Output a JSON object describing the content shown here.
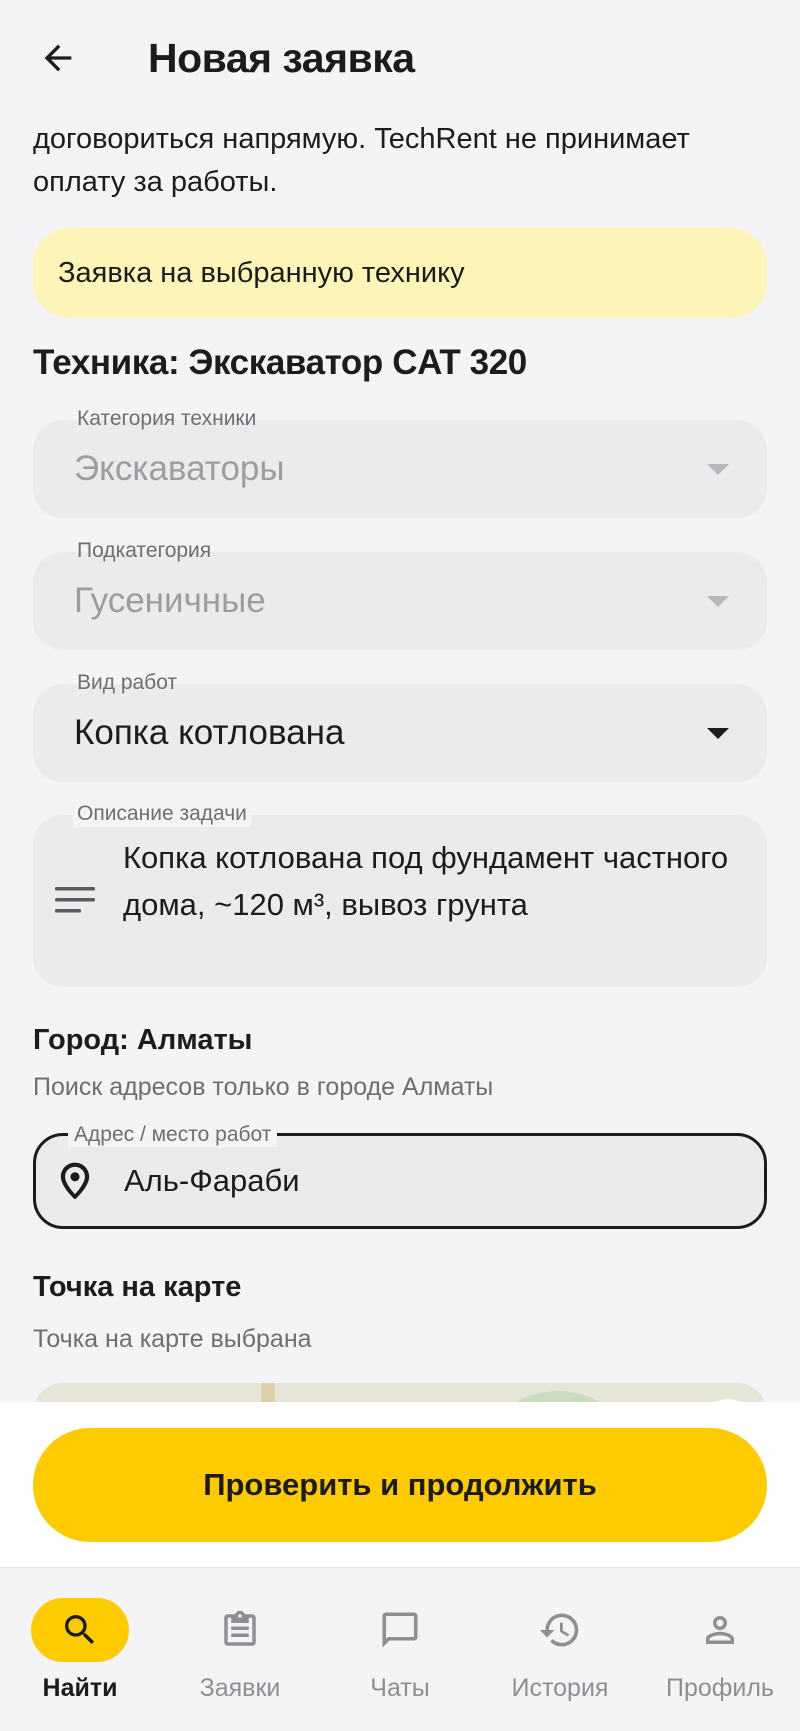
{
  "header": {
    "title": "Новая заявка",
    "back_icon": "arrow-left-icon"
  },
  "intro": {
    "text": "договориться напрямую. TechRent не принимает оплату за работы."
  },
  "banner": {
    "text": "Заявка на выбранную технику",
    "color": "#fdf4b8"
  },
  "equipment": {
    "title": "Техника: Экскаватор CAT 320"
  },
  "fields": {
    "category": {
      "label": "Категория техники",
      "value": "Экскаваторы",
      "disabled": true
    },
    "subcategory": {
      "label": "Подкатегория",
      "value": "Гусеничные",
      "disabled": true
    },
    "work_type": {
      "label": "Вид работ",
      "value": "Копка котлована",
      "disabled": false
    },
    "description": {
      "label": "Описание задачи",
      "value": "Копка котлована под фундамент частного дома, ~120 м³, вывоз грунта"
    }
  },
  "city": {
    "title": "Город: Алматы",
    "hint": "Поиск адресов только в городе Алматы"
  },
  "address": {
    "label": "Адрес / место работ",
    "value": "Аль-Фараби"
  },
  "map": {
    "title": "Точка на карте",
    "hint": "Точка на карте выбрана"
  },
  "actions": {
    "continue_label": "Проверить и продолжить",
    "accent_color": "#fdcb00"
  },
  "nav": {
    "items": [
      {
        "label": "Найти",
        "icon": "search-icon",
        "active": true
      },
      {
        "label": "Заявки",
        "icon": "clipboard-icon",
        "active": false
      },
      {
        "label": "Чаты",
        "icon": "chat-icon",
        "active": false
      },
      {
        "label": "История",
        "icon": "history-icon",
        "active": false
      },
      {
        "label": "Профиль",
        "icon": "person-icon",
        "active": false
      }
    ]
  }
}
